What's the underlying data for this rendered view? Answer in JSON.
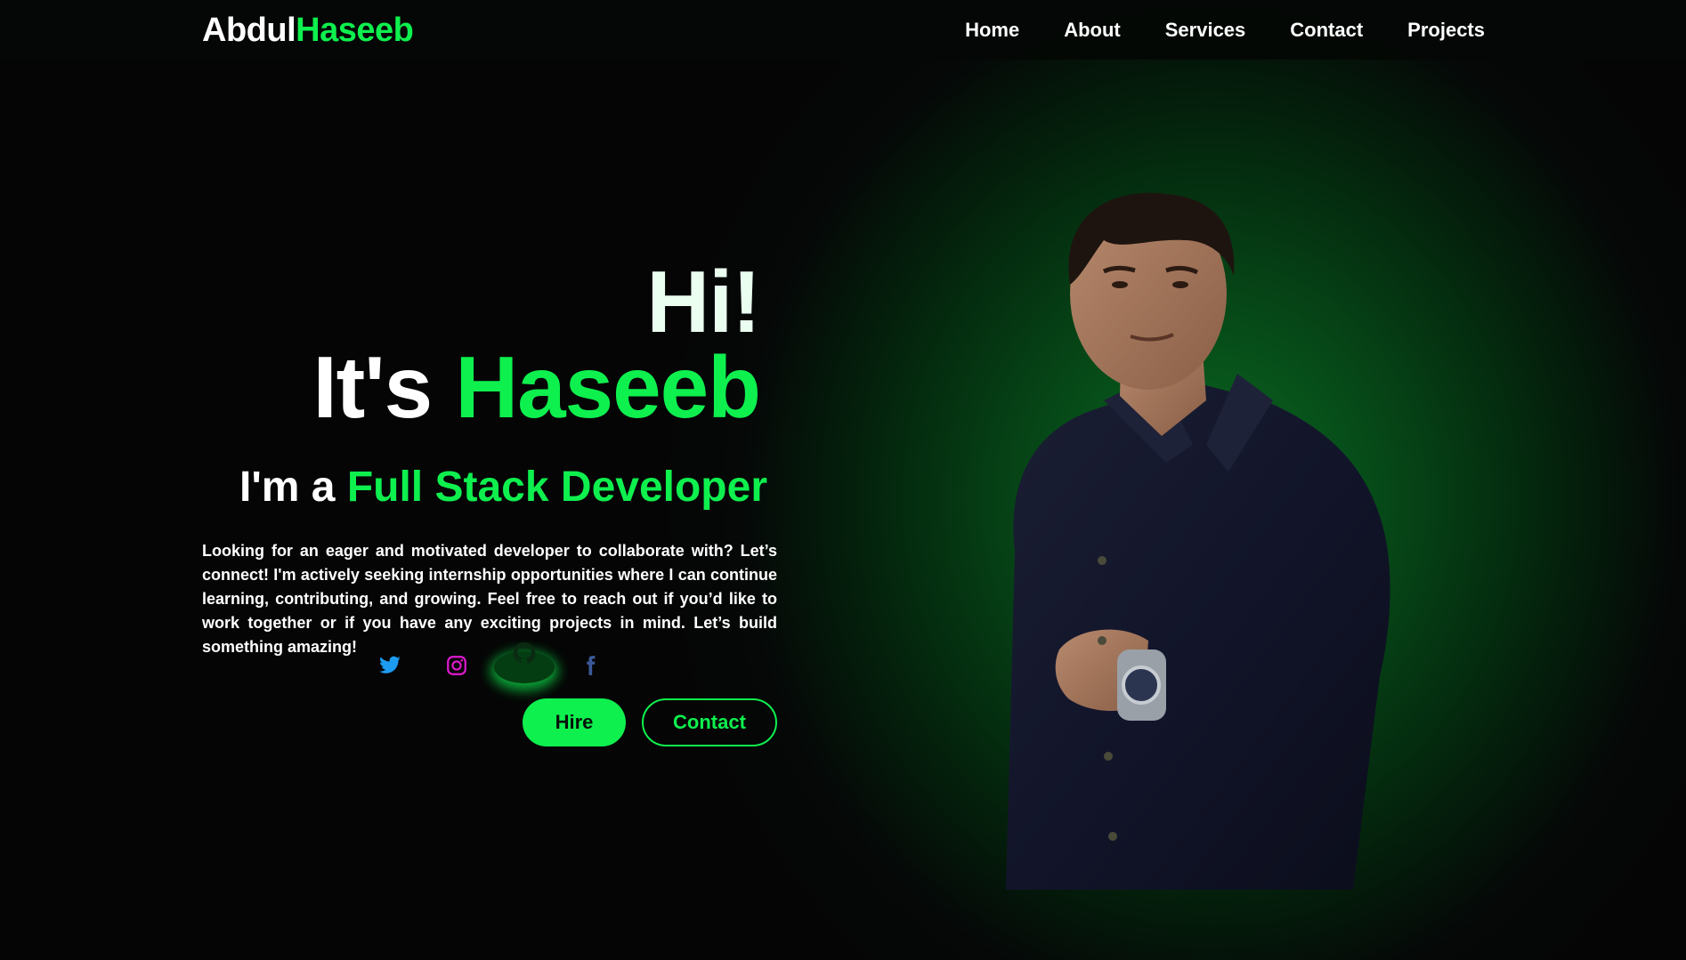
{
  "header": {
    "logo_first": "Abdul",
    "logo_last": "Haseeb",
    "nav": [
      {
        "label": "Home"
      },
      {
        "label": "About"
      },
      {
        "label": "Services"
      },
      {
        "label": "Contact"
      },
      {
        "label": "Projects"
      }
    ]
  },
  "hero": {
    "greeting": "Hi!",
    "intro_prefix": "It's",
    "name": "Haseeb",
    "role_prefix": "I'm a",
    "role": "Full Stack Developer",
    "bio": "Looking for an eager and motivated developer to collaborate with? Let’s connect! I'm actively seeking internship opportunities where I can continue learning, contributing, and growing. Feel free to reach out if you’d like to work together or if you have any exciting projects in mind. Let’s build something amazing!",
    "socials": [
      {
        "icon": "twitter-icon",
        "color": "#1d9bf0"
      },
      {
        "icon": "instagram-icon",
        "color": "#e01bd0"
      },
      {
        "icon": "github-icon",
        "color": "#0a2a12"
      },
      {
        "icon": "facebook-icon",
        "color": "#3b5998"
      }
    ],
    "hire_label": "Hire",
    "contact_label": "Contact"
  },
  "colors": {
    "accent": "#0ef04e",
    "background": "#050505",
    "glow": "#0b6a22"
  }
}
